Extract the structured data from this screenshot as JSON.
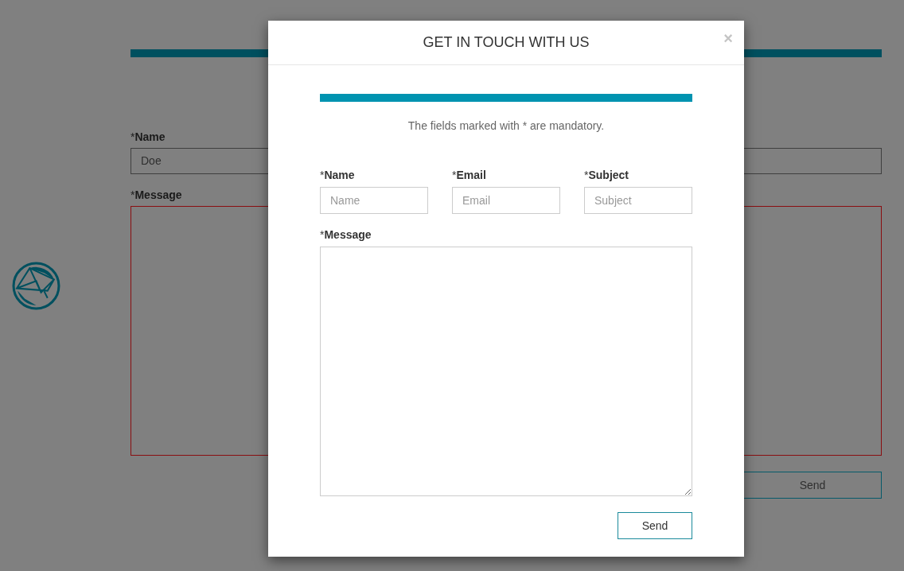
{
  "background_page": {
    "fields": [
      {
        "mark": "*",
        "label": "Name",
        "value": "Doe"
      }
    ],
    "message": {
      "mark": "*",
      "label": "Message",
      "invalid": true
    },
    "send_button": "Send"
  },
  "modal": {
    "title": "GET IN TOUCH WITH US",
    "close": "×",
    "notice": "The fields marked with * are mandatory.",
    "fields": [
      {
        "mark": "*",
        "label": "Name",
        "placeholder": "Name"
      },
      {
        "mark": "*",
        "label": "Email",
        "placeholder": "Email"
      },
      {
        "mark": "*",
        "label": "Subject",
        "placeholder": "Subject"
      }
    ],
    "message": {
      "mark": "*",
      "label": "Message",
      "invalid": false
    },
    "send_button": "Send"
  }
}
